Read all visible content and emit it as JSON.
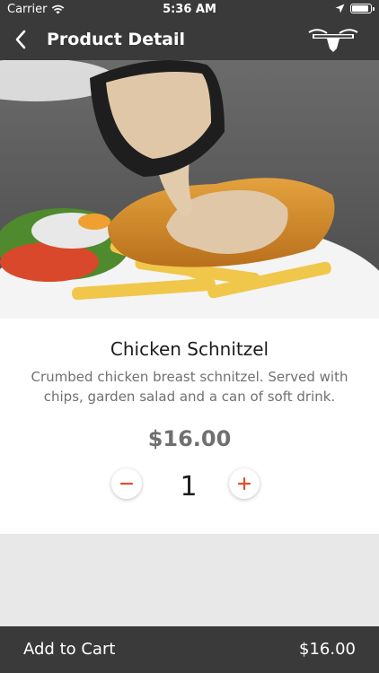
{
  "status_bar": {
    "carrier": "Carrier",
    "time": "5:36 AM"
  },
  "nav": {
    "title": "Product Detail",
    "back_icon": "chevron-left-icon",
    "logo_icon": "bull-logo-icon"
  },
  "product": {
    "name": "Chicken Schnitzel",
    "description": "Crumbed chicken breast schnitzel. Served with chips, garden salad and a can of soft drink.",
    "price": "$16.00",
    "quantity": "1"
  },
  "cart": {
    "label": "Add to Cart",
    "total": "$16.00"
  },
  "colors": {
    "dark_bar": "#3a3a3a",
    "accent": "#e0502a",
    "price_gray": "#707070"
  }
}
